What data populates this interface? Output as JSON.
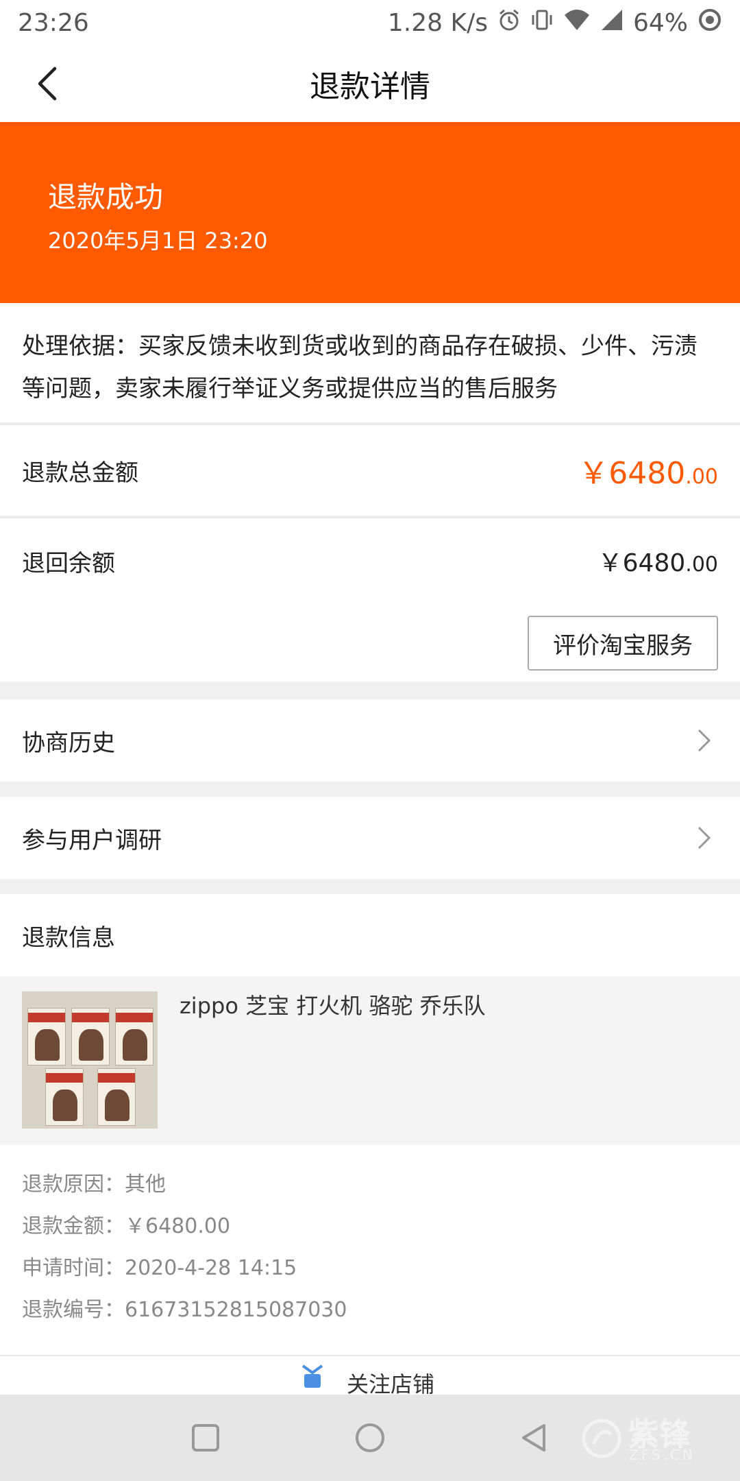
{
  "status_bar": {
    "time": "23:26",
    "net_speed": "1.28 K/s",
    "battery": "64%"
  },
  "nav": {
    "title": "退款详情"
  },
  "banner": {
    "title": "退款成功",
    "time": "2020年5月1日 23:20",
    "color": "#ff5a00"
  },
  "basis": {
    "text": "处理依据：买家反馈未收到货或收到的商品存在破损、少件、污渍等问题，卖家未履行举证义务或提供应当的售后服务"
  },
  "refund_total": {
    "label": "退款总金额",
    "currency": "￥",
    "int": "6480",
    "dec": ".00"
  },
  "refund_balance": {
    "label": "退回余额",
    "currency": "￥",
    "int": "6480",
    "dec": ".00",
    "rate_button": "评价淘宝服务"
  },
  "rows": {
    "negotiation": "协商历史",
    "survey": "参与用户调研"
  },
  "refund_info": {
    "heading": "退款信息",
    "product_title": "zippo 芝宝 打火机 骆驼 乔乐队",
    "reason": "退款原因：其他",
    "amount": "退款金额：￥6480.00",
    "apply_time": "申请时间：2020-4-28 14:15",
    "refund_no": "退款编号：61673152815087030",
    "more_partial": "关注店铺"
  },
  "watermark": {
    "main": "紫锋",
    "sub": "ZFS.CN"
  }
}
